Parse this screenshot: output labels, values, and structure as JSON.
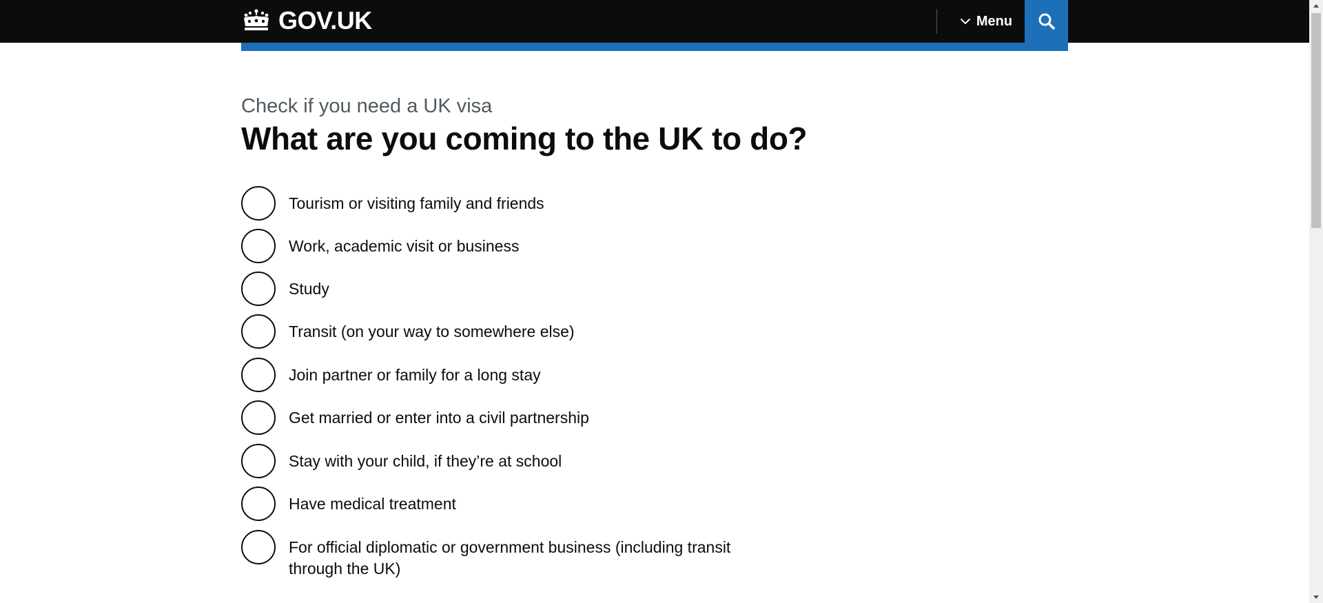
{
  "header": {
    "logo_text": "GOV.UK",
    "menu_label": "Menu",
    "brand_color": "#1d70b8",
    "background": "#0b0c0c"
  },
  "main": {
    "caption": "Check if you need a UK visa",
    "heading": "What are you coming to the UK to do?",
    "options": [
      {
        "label": "Tourism or visiting family and friends",
        "selected": false
      },
      {
        "label": "Work, academic visit or business",
        "selected": false
      },
      {
        "label": "Study",
        "selected": false
      },
      {
        "label": "Transit (on your way to somewhere else)",
        "selected": false
      },
      {
        "label": "Join partner or family for a long stay",
        "selected": false
      },
      {
        "label": "Get married or enter into a civil partnership",
        "selected": false
      },
      {
        "label": "Stay with your child, if they’re at school",
        "selected": false
      },
      {
        "label": "Have medical treatment",
        "selected": false
      },
      {
        "label": "For official diplomatic or government business (including transit through the UK)",
        "selected": false
      }
    ]
  },
  "icons": {
    "logo": "crown-icon",
    "menu": "chevron-down-icon",
    "search": "search-icon"
  }
}
